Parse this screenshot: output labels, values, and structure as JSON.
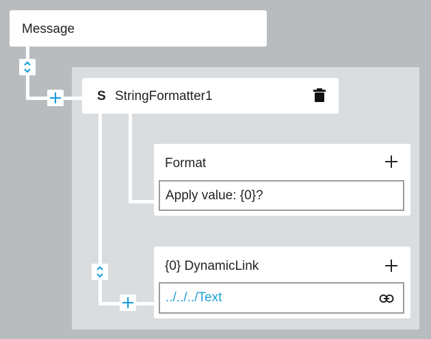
{
  "nodes": {
    "message": {
      "label": "Message"
    },
    "string_formatter": {
      "badge": "S",
      "label": "StringFormatter1"
    },
    "format": {
      "label": "Format",
      "value": "Apply value: {0}?"
    },
    "dynamic_link": {
      "label": "{0} DynamicLink",
      "path": "../../../Text"
    }
  },
  "icons": {
    "add": "plus-icon",
    "reorder": "chevron-up-down-icon",
    "delete": "trash-icon",
    "link": "link-icon"
  },
  "colors": {
    "accent": "#1a9fd8",
    "background": "#b9bcbf",
    "panel": "#dadddf"
  }
}
